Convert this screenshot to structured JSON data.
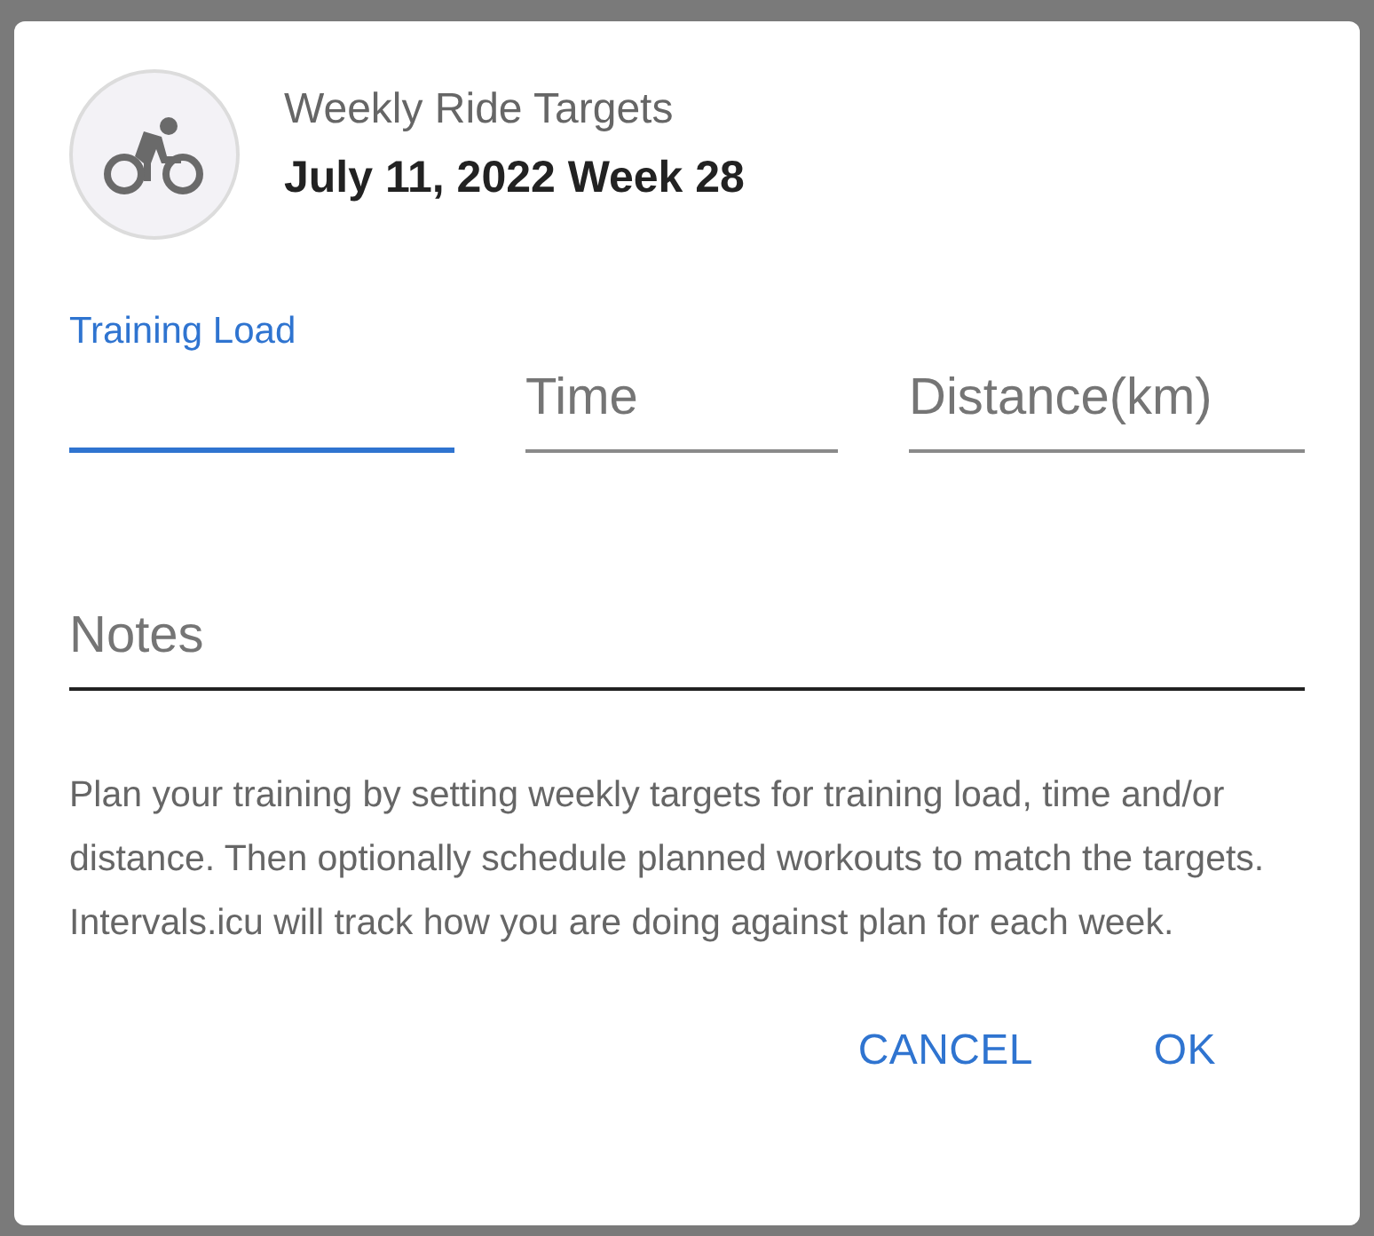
{
  "dialog": {
    "title": "Weekly Ride Targets",
    "subtitle": "July 11, 2022 Week 28",
    "fields": [
      {
        "label": "Training Load",
        "focused": true
      },
      {
        "label": "Time",
        "focused": false
      },
      {
        "label": "Distance(km)",
        "focused": false
      }
    ],
    "notes": {
      "label": "Notes",
      "focused": false
    },
    "description": "Plan your training by setting weekly targets for training load, time and/or distance. Then optionally schedule planned workouts to match the targets. Intervals.icu will track how you are doing against plan for each week.",
    "buttons": [
      "CANCEL",
      "OK"
    ]
  }
}
